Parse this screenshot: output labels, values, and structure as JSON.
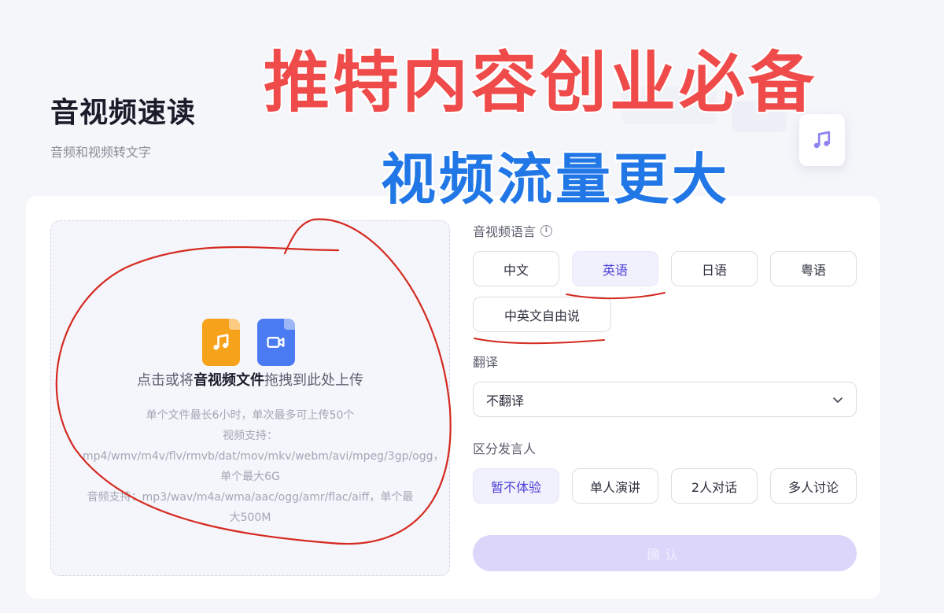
{
  "header": {
    "title": "音视频速读",
    "subtitle": "音频和视频转文字"
  },
  "promo": {
    "line1": "推特内容创业必备",
    "line2": "视频流量更大"
  },
  "upload": {
    "prompt_before": "点击或将",
    "prompt_bold": "音视频文件",
    "prompt_after": "拖拽到此处上传",
    "hint_limits": "单个文件最长6小时，单次最多可上传50个",
    "hint_video": "视频支持：mp4/wmv/m4v/flv/rmvb/dat/mov/mkv/webm/avi/mpeg/3gp/ogg，单个最大6G",
    "hint_audio": "音频支持：mp3/wav/m4a/wma/aac/ogg/amr/flac/aiff，单个最大500M"
  },
  "form": {
    "language_label": "音视频语言",
    "languages": [
      "中文",
      "英语",
      "日语",
      "粤语",
      "中英文自由说"
    ],
    "language_selected": "英语",
    "translate_label": "翻译",
    "translate_value": "不翻译",
    "speaker_label": "区分发言人",
    "speakers": [
      "暂不体验",
      "单人演讲",
      "2人对话",
      "多人讨论"
    ],
    "speaker_selected": "暂不体验",
    "confirm_label": "确认"
  },
  "colors": {
    "accent": "#4a3fd8",
    "accent_bg": "#f1f0fd",
    "confirm_disabled": "#dcd6fb",
    "promo_red": "#ef4b4b",
    "promo_blue": "#2177e6",
    "annotation_red": "#d42a1f"
  },
  "icons": [
    "audio-file-icon",
    "video-file-icon",
    "music-note-icon",
    "info-icon",
    "chevron-down-icon"
  ]
}
